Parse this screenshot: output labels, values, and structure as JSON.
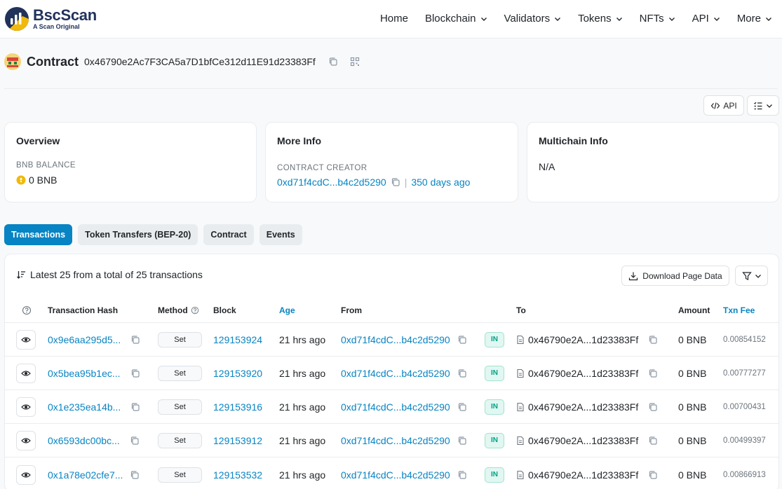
{
  "header": {
    "brand": "BscScan",
    "tagline": "A Scan Original",
    "nav": [
      "Home",
      "Blockchain",
      "Validators",
      "Tokens",
      "NFTs",
      "API",
      "More"
    ]
  },
  "contract": {
    "label": "Contract",
    "address": "0x46790e2Ac7F3CA5a7D1bfCe312d11E91d23383Ff"
  },
  "buttons": {
    "api": "API"
  },
  "overview": {
    "title": "Overview",
    "balance_label": "BNB BALANCE",
    "balance_value": "0 BNB"
  },
  "more_info": {
    "title": "More Info",
    "creator_label": "CONTRACT CREATOR",
    "creator": "0xd71f4cdC...b4c2d5290",
    "separator": "|",
    "age": "350 days ago"
  },
  "multichain": {
    "title": "Multichain Info",
    "value": "N/A"
  },
  "tabs": [
    "Transactions",
    "Token Transfers (BEP-20)",
    "Contract",
    "Events"
  ],
  "tx": {
    "summary": "Latest 25 from a total of 25 transactions",
    "download": "Download Page Data",
    "headers": {
      "hash": "Transaction Hash",
      "method": "Method",
      "block": "Block",
      "age": "Age",
      "from": "From",
      "to": "To",
      "amount": "Amount",
      "fee": "Txn Fee"
    },
    "rows": [
      {
        "hash": "0x9e6aa295d5...",
        "method": "Set",
        "block": "129153924",
        "age": "21 hrs ago",
        "from": "0xd71f4cdC...b4c2d5290",
        "dir": "IN",
        "to": "0x46790e2A...1d23383Ff",
        "amount": "0 BNB",
        "fee": "0.00854152"
      },
      {
        "hash": "0x5bea95b1ec...",
        "method": "Set",
        "block": "129153920",
        "age": "21 hrs ago",
        "from": "0xd71f4cdC...b4c2d5290",
        "dir": "IN",
        "to": "0x46790e2A...1d23383Ff",
        "amount": "0 BNB",
        "fee": "0.00777277"
      },
      {
        "hash": "0x1e235ea14b...",
        "method": "Set",
        "block": "129153916",
        "age": "21 hrs ago",
        "from": "0xd71f4cdC...b4c2d5290",
        "dir": "IN",
        "to": "0x46790e2A...1d23383Ff",
        "amount": "0 BNB",
        "fee": "0.00700431"
      },
      {
        "hash": "0x6593dc00bc...",
        "method": "Set",
        "block": "129153912",
        "age": "21 hrs ago",
        "from": "0xd71f4cdC...b4c2d5290",
        "dir": "IN",
        "to": "0x46790e2A...1d23383Ff",
        "amount": "0 BNB",
        "fee": "0.00499397"
      },
      {
        "hash": "0x1a78e02cfe7...",
        "method": "Set",
        "block": "129153532",
        "age": "21 hrs ago",
        "from": "0xd71f4cdC...b4c2d5290",
        "dir": "IN",
        "to": "0x46790e2A...1d23383Ff",
        "amount": "0 BNB",
        "fee": "0.00866913"
      }
    ]
  },
  "colors": {
    "brand_dark": "#21325b",
    "link": "#0784c3",
    "accent_yellow": "#f0b90b",
    "in_green": "#00a186"
  },
  "icons": [
    "bscscan-logo",
    "chevron-down-icon",
    "copy-icon",
    "qr-code-icon",
    "api-code-icon",
    "list-settings-icon",
    "bnb-coin-icon",
    "sort-icon",
    "download-icon",
    "filter-icon",
    "help-circle-icon",
    "eye-icon",
    "document-icon"
  ]
}
